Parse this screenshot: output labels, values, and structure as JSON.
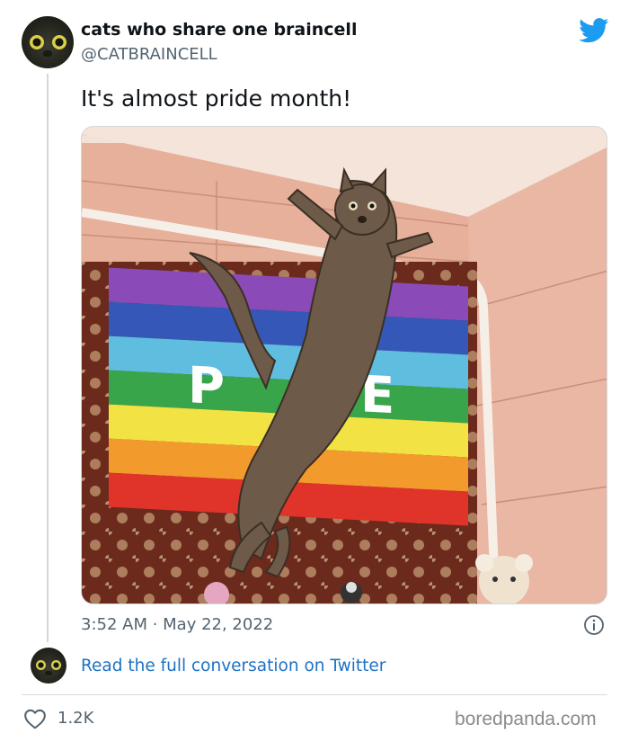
{
  "author": {
    "display_name": "cats who share one braincell",
    "handle": "@CATBRAINCELL",
    "avatar_icon": "cat-face-avatar"
  },
  "tweet": {
    "text": "It's almost pride month!",
    "timestamp": "3:52 AM · May 22, 2022",
    "media_description": "cat-jumping-in-front-of-rainbow-pace-flag"
  },
  "actions": {
    "read_conversation": "Read the full conversation on Twitter",
    "like_count": "1.2K"
  },
  "icons": {
    "brand": "twitter-bird-icon",
    "info": "info-icon",
    "like": "heart-icon"
  },
  "colors": {
    "twitter_blue": "#1d9bf0",
    "link": "#1d72c5",
    "secondary_text": "#536471"
  },
  "watermark": "boredpanda.com"
}
